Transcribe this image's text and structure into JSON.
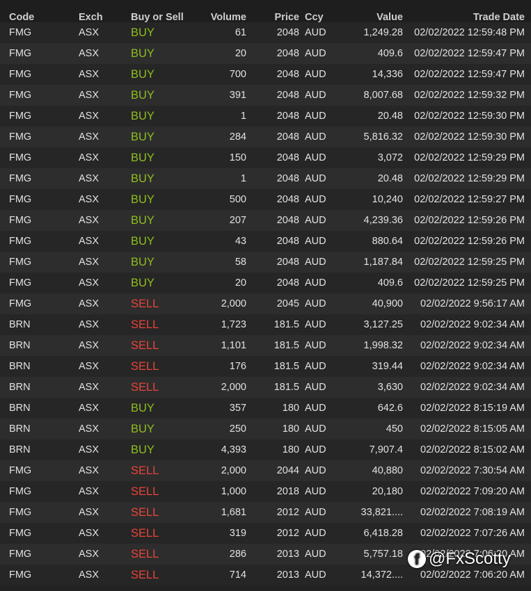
{
  "columns": {
    "code": "Code",
    "exch": "Exch",
    "side": "Buy or Sell",
    "volume": "Volume",
    "price": "Price",
    "ccy": "Ccy",
    "value": "Value",
    "date": "Trade Date"
  },
  "colors": {
    "buy": "#8fbe1f",
    "sell": "#e8443a",
    "background": "#232323"
  },
  "rows": [
    [
      "FMG",
      "ASX",
      "BUY",
      "61",
      "2048",
      "AUD",
      "1,249.28",
      "02/02/2022 12:59:48 PM"
    ],
    [
      "FMG",
      "ASX",
      "BUY",
      "20",
      "2048",
      "AUD",
      "409.6",
      "02/02/2022 12:59:47 PM"
    ],
    [
      "FMG",
      "ASX",
      "BUY",
      "700",
      "2048",
      "AUD",
      "14,336",
      "02/02/2022 12:59:47 PM"
    ],
    [
      "FMG",
      "ASX",
      "BUY",
      "391",
      "2048",
      "AUD",
      "8,007.68",
      "02/02/2022 12:59:32 PM"
    ],
    [
      "FMG",
      "ASX",
      "BUY",
      "1",
      "2048",
      "AUD",
      "20.48",
      "02/02/2022 12:59:30 PM"
    ],
    [
      "FMG",
      "ASX",
      "BUY",
      "284",
      "2048",
      "AUD",
      "5,816.32",
      "02/02/2022 12:59:30 PM"
    ],
    [
      "FMG",
      "ASX",
      "BUY",
      "150",
      "2048",
      "AUD",
      "3,072",
      "02/02/2022 12:59:29 PM"
    ],
    [
      "FMG",
      "ASX",
      "BUY",
      "1",
      "2048",
      "AUD",
      "20.48",
      "02/02/2022 12:59:29 PM"
    ],
    [
      "FMG",
      "ASX",
      "BUY",
      "500",
      "2048",
      "AUD",
      "10,240",
      "02/02/2022 12:59:27 PM"
    ],
    [
      "FMG",
      "ASX",
      "BUY",
      "207",
      "2048",
      "AUD",
      "4,239.36",
      "02/02/2022 12:59:26 PM"
    ],
    [
      "FMG",
      "ASX",
      "BUY",
      "43",
      "2048",
      "AUD",
      "880.64",
      "02/02/2022 12:59:26 PM"
    ],
    [
      "FMG",
      "ASX",
      "BUY",
      "58",
      "2048",
      "AUD",
      "1,187.84",
      "02/02/2022 12:59:25 PM"
    ],
    [
      "FMG",
      "ASX",
      "BUY",
      "20",
      "2048",
      "AUD",
      "409.6",
      "02/02/2022 12:59:25 PM"
    ],
    [
      "FMG",
      "ASX",
      "SELL",
      "2,000",
      "2045",
      "AUD",
      "40,900",
      "02/02/2022 9:56:17 AM"
    ],
    [
      "BRN",
      "ASX",
      "SELL",
      "1,723",
      "181.5",
      "AUD",
      "3,127.25",
      "02/02/2022 9:02:34 AM"
    ],
    [
      "BRN",
      "ASX",
      "SELL",
      "1,101",
      "181.5",
      "AUD",
      "1,998.32",
      "02/02/2022 9:02:34 AM"
    ],
    [
      "BRN",
      "ASX",
      "SELL",
      "176",
      "181.5",
      "AUD",
      "319.44",
      "02/02/2022 9:02:34 AM"
    ],
    [
      "BRN",
      "ASX",
      "SELL",
      "2,000",
      "181.5",
      "AUD",
      "3,630",
      "02/02/2022 9:02:34 AM"
    ],
    [
      "BRN",
      "ASX",
      "BUY",
      "357",
      "180",
      "AUD",
      "642.6",
      "02/02/2022 8:15:19 AM"
    ],
    [
      "BRN",
      "ASX",
      "BUY",
      "250",
      "180",
      "AUD",
      "450",
      "02/02/2022 8:15:05 AM"
    ],
    [
      "BRN",
      "ASX",
      "BUY",
      "4,393",
      "180",
      "AUD",
      "7,907.4",
      "02/02/2022 8:15:02 AM"
    ],
    [
      "FMG",
      "ASX",
      "SELL",
      "2,000",
      "2044",
      "AUD",
      "40,880",
      "02/02/2022 7:30:54 AM"
    ],
    [
      "FMG",
      "ASX",
      "SELL",
      "1,000",
      "2018",
      "AUD",
      "20,180",
      "02/02/2022 7:09:20 AM"
    ],
    [
      "FMG",
      "ASX",
      "SELL",
      "1,681",
      "2012",
      "AUD",
      "33,821....",
      "02/02/2022 7:08:19 AM"
    ],
    [
      "FMG",
      "ASX",
      "SELL",
      "319",
      "2012",
      "AUD",
      "6,418.28",
      "02/02/2022 7:07:26 AM"
    ],
    [
      "FMG",
      "ASX",
      "SELL",
      "286",
      "2013",
      "AUD",
      "5,757.18",
      "02/02/2022 7:06:20 AM"
    ],
    [
      "FMG",
      "ASX",
      "SELL",
      "714",
      "2013",
      "AUD",
      "14,372....",
      "02/02/2022 7:06:20 AM"
    ]
  ],
  "watermark": {
    "text": "@FxScotty",
    "icon": "facebook-icon"
  }
}
